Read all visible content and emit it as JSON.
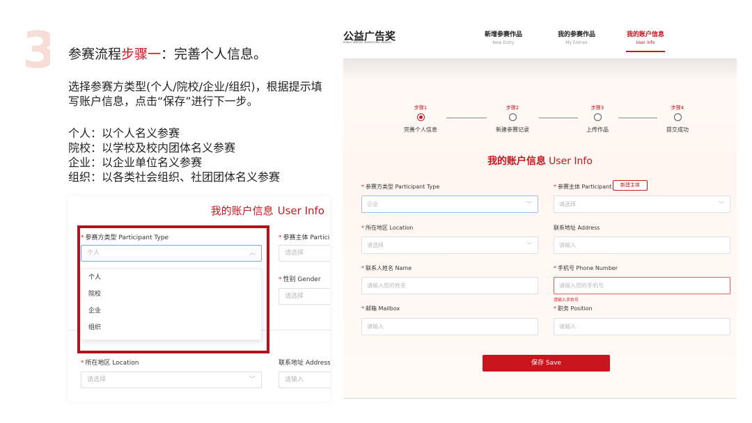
{
  "slide": {
    "step_number": "3",
    "heading_prefix": "参赛流程",
    "heading_accent": "步骤一",
    "heading_suffix": "：完善个人信息。",
    "paragraph": "选择参赛方类型(个人/院校/企业/组织)，根据提示填写账户信息，点击“保存”进行下一步。",
    "types": [
      "个人：以个人名义参赛",
      "院校：以学校及校内团体名义参赛",
      "企业：以企业单位名义参赛",
      "组织：以各类社会组织、社团团体名义参赛"
    ]
  },
  "crop": {
    "title_zh": "我的账户信息",
    "title_en": "User Info",
    "participant_type_label": "参赛方类型 Participant Type",
    "participant_type_value": "个人",
    "participant_label": "参赛主体 Participa",
    "participant_placeholder": "请选择",
    "gender_label": "性别 Gender",
    "gender_placeholder": "请选择",
    "dropdown_options": [
      "个人",
      "院校",
      "企业",
      "组织"
    ],
    "location_label": "所在地区 Location",
    "location_placeholder": "请选择",
    "address_label": "联系地址 Address",
    "address_placeholder": "请输入"
  },
  "app": {
    "logo": "公益广告奖",
    "logo_sub": "PUBLIC SERVICE ADVERTISING AWARDS",
    "nav": [
      {
        "zh": "新增参赛作品",
        "en": "New Entry"
      },
      {
        "zh": "我的参赛作品",
        "en": "My Entries"
      },
      {
        "zh": "我的账户信息",
        "en": "User Info"
      }
    ],
    "steps": [
      {
        "num": "步骤1",
        "name": "完善个人信息"
      },
      {
        "num": "步骤2",
        "name": "新建参赛记录"
      },
      {
        "num": "步骤3",
        "name": "上传作品"
      },
      {
        "num": "步骤4",
        "name": "提交成功"
      }
    ],
    "form_title_zh": "我的账户信息",
    "form_title_en": "User Info",
    "fields": {
      "participant_type": {
        "label": "参赛方类型 Participant Type",
        "value": "企业"
      },
      "participant": {
        "label": "参赛主体 Participant",
        "placeholder": "请选择",
        "button": "新建主体"
      },
      "location": {
        "label": "所在地区 Location",
        "placeholder": "请选择"
      },
      "address": {
        "label": "联系地址 Address",
        "placeholder": "请输入"
      },
      "name": {
        "label": "联系人姓名 Name",
        "placeholder": "请输入您的姓名"
      },
      "phone": {
        "label": "手机号 Phone Number",
        "placeholder": "请输入您的手机号",
        "error": "请输入手机号"
      },
      "mailbox": {
        "label": "邮箱 Mailbox",
        "placeholder": "请输入"
      },
      "position": {
        "label": "职务 Position",
        "placeholder": "请输入"
      }
    },
    "save_label": "保存 Save"
  }
}
